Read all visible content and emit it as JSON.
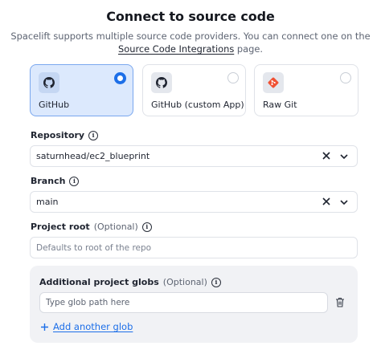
{
  "header": {
    "title": "Connect to source code",
    "subtitle_line1": "Spacelift supports multiple source code providers. You can connect one on the",
    "subtitle_link": "Source Code Integrations",
    "subtitle_after_link": " page."
  },
  "providers": [
    {
      "label": "GitHub",
      "icon": "github-icon",
      "selected": true
    },
    {
      "label": "GitHub (custom App)",
      "icon": "github-icon",
      "selected": false
    },
    {
      "label": "Raw Git",
      "icon": "git-icon",
      "selected": false
    }
  ],
  "repository": {
    "label": "Repository",
    "value": "saturnhead/ec2_blueprint"
  },
  "branch": {
    "label": "Branch",
    "value": "main"
  },
  "project_root": {
    "label": "Project root",
    "optional": "(Optional)",
    "placeholder": "Defaults to root of the repo"
  },
  "globs": {
    "label": "Additional project globs",
    "optional": "(Optional)",
    "placeholder": "Type glob path here",
    "add_label": "Add another glob"
  },
  "colors": {
    "accent": "#1d6fe8",
    "selected_bg": "#dce9fd",
    "git_orange": "#f05133"
  }
}
